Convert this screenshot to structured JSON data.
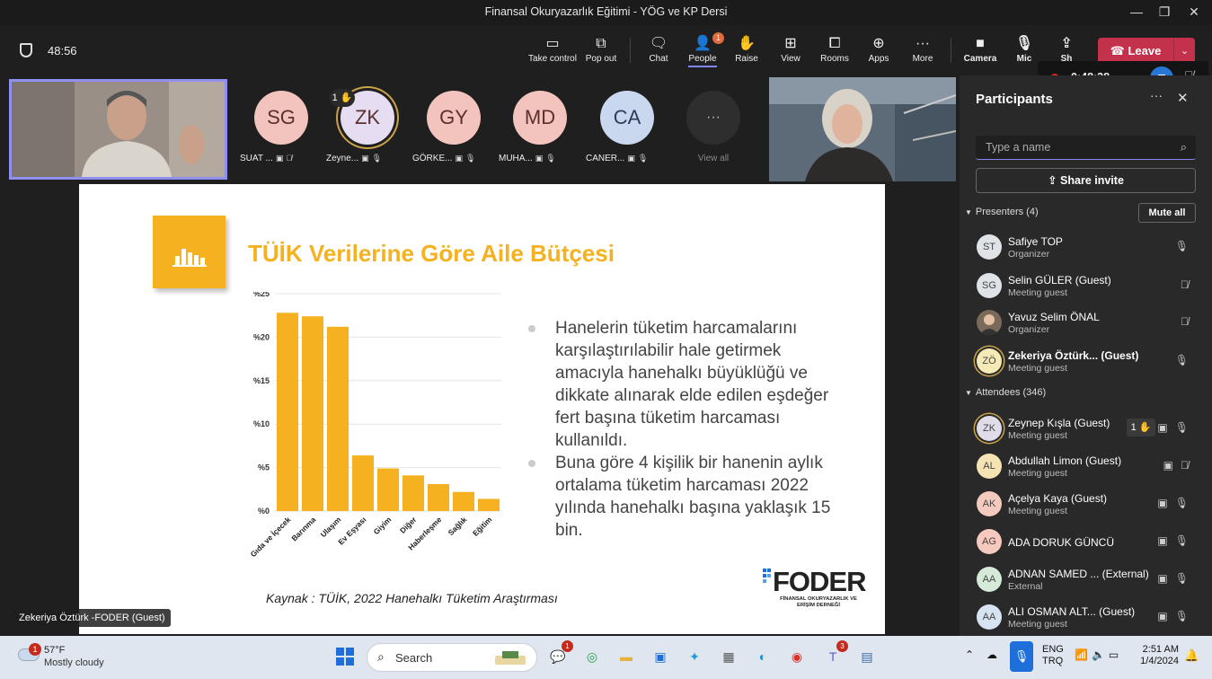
{
  "window": {
    "title": "Finansal Okuryazarlık Eğitimi - YÖG ve KP Dersi",
    "minimize": "—",
    "restore": "❐",
    "close": "✕"
  },
  "toolbar": {
    "elapsed": "48:56",
    "take_control": "Take control",
    "pop_out": "Pop out",
    "chat": "Chat",
    "people": "People",
    "people_badge": "1",
    "raise": "Raise",
    "view": "View",
    "rooms": "Rooms",
    "apps": "Apps",
    "more": "More",
    "camera": "Camera",
    "mic": "Mic",
    "share": "Sh",
    "leave": "Leave"
  },
  "recording": {
    "time": "0:48:38"
  },
  "stage": {
    "avatars": [
      {
        "initials": "SG",
        "name": "SUAT ...",
        "color": "#f2c4bd"
      },
      {
        "initials": "ZK",
        "name": "Zeyne...",
        "color": "#e6ddf2",
        "hand": "1 ✋"
      },
      {
        "initials": "GY",
        "name": "GÖRKE...",
        "color": "#f2c4bd"
      },
      {
        "initials": "MD",
        "name": "MUHA...",
        "color": "#f2c4bd"
      },
      {
        "initials": "CA",
        "name": "CANER...",
        "color": "#c9d8ee"
      }
    ],
    "view_all": "View all",
    "speaker_label": "Zekeriya Öztürk -FODER (Guest)"
  },
  "slide": {
    "title": "TÜİK Verilerine Göre Aile Bütçesi",
    "bullets": [
      "Hanelerin tüketim harcamalarını karşılaştırılabilir hale getirmek amacıyla hanehalkı büyüklüğü ve dikkate alınarak elde edilen eşdeğer fert başına tüketim harcaması kullanıldı.",
      "Buna göre 4 kişilik bir hanenin aylık ortalama tüketim harcaması 2022 yılında hanehalkı başına yaklaşık 15 bin."
    ],
    "source": "Kaynak : TÜİK, 2022 Hanehalkı Tüketim Araştırması",
    "logo_word": "FODER",
    "logo_sub": "FİNANSAL OKURYAZARLIK VE ERİŞİM DERNEĞİ"
  },
  "chart_data": {
    "type": "bar",
    "categories": [
      "Gıda ve İçecek",
      "Barınma",
      "Ulaşım",
      "Ev Eşyası",
      "Giyim",
      "Diğer",
      "Haberleşme",
      "Sağlık",
      "Eğitim"
    ],
    "values": [
      22.8,
      22.4,
      21.2,
      6.4,
      4.9,
      4.1,
      3.1,
      2.2,
      1.4
    ],
    "ylim": [
      0,
      25
    ],
    "yticks": [
      "%0",
      "%5",
      "%10",
      "%15",
      "%20",
      "%25"
    ],
    "color": "#f5b120",
    "grid": true
  },
  "panel": {
    "title": "Participants",
    "search_placeholder": "Type a name",
    "share_invite": "Share invite",
    "presenters_label": "Presenters (4)",
    "mute_all": "Mute all",
    "attendees_label": "Attendees (346)",
    "presenters": [
      {
        "initials": "ST",
        "name": "Safiye TOP",
        "role": "Organizer",
        "color": "#dfe3e8",
        "mic": "on"
      },
      {
        "initials": "SG",
        "name": "Selin GÜLER (Guest)",
        "role": "Meeting guest",
        "color": "#dfe3e8",
        "mic": "off"
      },
      {
        "initials": "",
        "name": "Yavuz Selim ÖNAL",
        "role": "Organizer",
        "color": "#7a6a5a",
        "mic": "off"
      },
      {
        "initials": "ZÖ",
        "name": "Zekeriya Öztürk...  (Guest)",
        "role": "Meeting guest",
        "color": "#f5e9b6",
        "mic": "on"
      }
    ],
    "attendees": [
      {
        "initials": "ZK",
        "name": "Zeynep Kışla (Guest)",
        "role": "Meeting guest",
        "color": "#e0dde8",
        "hand": "1 ✋"
      },
      {
        "initials": "AL",
        "name": "Abdullah Limon (Guest)",
        "role": "Meeting guest",
        "color": "#f5e3b3"
      },
      {
        "initials": "AK",
        "name": "Açelya Kaya (Guest)",
        "role": "Meeting guest",
        "color": "#f5c9bd"
      },
      {
        "initials": "AG",
        "name": "ADA DORUK GÜNCÜ",
        "role": "",
        "color": "#f5c9bd"
      },
      {
        "initials": "AA",
        "name": "ADNAN SAMED ... (External)",
        "role": "External",
        "color": "#d6ead9"
      },
      {
        "initials": "AA",
        "name": "ALI OSMAN ALT...  (Guest)",
        "role": "Meeting guest",
        "color": "#d6e3f0"
      }
    ]
  },
  "taskbar": {
    "weather_badge": "1",
    "temp": "57°F",
    "condition": "Mostly cloudy",
    "search": "Search",
    "lang1": "ENG",
    "lang2": "TRQ",
    "time": "2:51 AM",
    "date": "1/4/2024",
    "chat_badge": "1",
    "teams_badge": "3"
  }
}
